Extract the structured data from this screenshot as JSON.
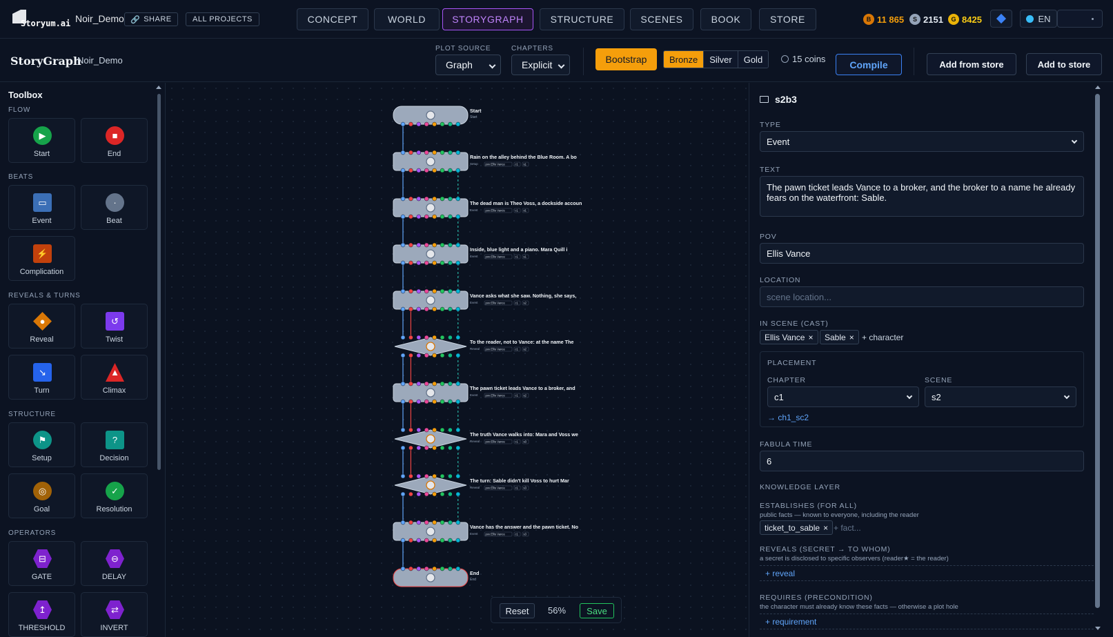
{
  "app": {
    "logo_text": "Storyum.ai",
    "project_name": "Noir_Demo",
    "share": "SHARE",
    "all_projects": "ALL PROJECTS"
  },
  "nav": {
    "tabs": [
      "CONCEPT",
      "WORLD",
      "STORYGRAPH",
      "STRUCTURE",
      "SCENES",
      "BOOK",
      "STORE"
    ],
    "active": "STORYGRAPH"
  },
  "wallet": {
    "bronze": "11 865",
    "silver": "2151",
    "gold": "8425",
    "bronze_letter": "B",
    "silver_letter": "S",
    "gold_letter": "G"
  },
  "lang": "EN",
  "subbar": {
    "title": "StoryGraph",
    "project": "Noir_Demo",
    "plot_source_label": "PLOT SOURCE",
    "plot_source_value": "Graph",
    "chapters_label": "CHAPTERS",
    "chapters_value": "Explicit",
    "bootstrap": "Bootstrap",
    "tiers": [
      "Bronze",
      "Silver",
      "Gold"
    ],
    "active_tier": "Bronze",
    "coins": "15 coins",
    "compile": "Compile",
    "add_from_store": "Add from store",
    "add_to_store": "Add to store"
  },
  "toolbox": {
    "title": "Toolbox",
    "sections": [
      "FLOW",
      "BEATS",
      "REVEALS & TURNS",
      "STRUCTURE",
      "OPERATORS"
    ],
    "tools": [
      {
        "label": "Start",
        "icon": "play-icon",
        "glyph": "▶",
        "color": "#16a34a"
      },
      {
        "label": "End",
        "icon": "stop-icon",
        "glyph": "■",
        "color": "#dc2626"
      },
      {
        "label": "Event",
        "icon": "event-icon",
        "glyph": "▭",
        "color": "#3b6fb6"
      },
      {
        "label": "Beat",
        "icon": "beat-icon",
        "glyph": "·",
        "color": "#64748b"
      },
      {
        "label": "Complication",
        "icon": "lightning-icon",
        "glyph": "⚡",
        "color": "#c2410c"
      },
      {
        "label": "Reveal",
        "icon": "bulb-icon",
        "glyph": "●",
        "color": "#d97706"
      },
      {
        "label": "Twist",
        "icon": "twist-icon",
        "glyph": "↺",
        "color": "#7c3aed"
      },
      {
        "label": "Turn",
        "icon": "turn-icon",
        "glyph": "↘",
        "color": "#2563eb"
      },
      {
        "label": "Climax",
        "icon": "climax-icon",
        "glyph": "▲",
        "color": "#dc2626"
      },
      {
        "label": "Setup",
        "icon": "flag-icon",
        "glyph": "⚑",
        "color": "#0d9488"
      },
      {
        "label": "Decision",
        "icon": "question-icon",
        "glyph": "?",
        "color": "#0d9488"
      },
      {
        "label": "Goal",
        "icon": "target-icon",
        "glyph": "◎",
        "color": "#a16207"
      },
      {
        "label": "Resolution",
        "icon": "check-icon",
        "glyph": "✓",
        "color": "#16a34a"
      },
      {
        "label": "GATE",
        "icon": "gate-icon",
        "glyph": "⊟",
        "color": "#7e22ce"
      },
      {
        "label": "DELAY",
        "icon": "delay-icon",
        "glyph": "⊖",
        "color": "#7e22ce"
      },
      {
        "label": "THRESHOLD",
        "icon": "threshold-icon",
        "glyph": "↥",
        "color": "#7e22ce"
      },
      {
        "label": "INVERT",
        "icon": "invert-icon",
        "glyph": "⇄",
        "color": "#7e22ce"
      }
    ]
  },
  "graph": {
    "nodes": [
      {
        "kind": "start",
        "title": "Start",
        "meta": "Start"
      },
      {
        "kind": "event",
        "title": "Rain on the alley behind the Blue Room. A bo",
        "type": "Setup",
        "pov": "pov:Ellis Vance",
        "ch": "c1",
        "sc": "s1"
      },
      {
        "kind": "event",
        "title": "The dead man is Theo Voss, a dockside accoun",
        "type": "Event",
        "pov": "pov:Ellis Vance",
        "ch": "c1",
        "sc": "s1"
      },
      {
        "kind": "event",
        "title": "Inside, blue light and a piano. Mara Quill i",
        "type": "Event",
        "pov": "pov:Ellis Vance",
        "ch": "c1",
        "sc": "s1"
      },
      {
        "kind": "event",
        "title": "Vance asks what she saw. Nothing, she says,",
        "type": "Event",
        "pov": "pov:Ellis Vance",
        "ch": "c1",
        "sc": "s2"
      },
      {
        "kind": "reveal",
        "title": "To the reader, not to Vance: at the name The",
        "type": "Reveal",
        "pov": "pov:Ellis Vance",
        "ch": "c1",
        "sc": "s2"
      },
      {
        "kind": "event",
        "title": "The pawn ticket leads Vance to a broker, and",
        "type": "Event",
        "pov": "pov:Ellis Vance",
        "ch": "c1",
        "sc": "s2"
      },
      {
        "kind": "reveal",
        "title": "The truth Vance walks into: Mara and Voss we",
        "type": "Reveal",
        "pov": "pov:Ellis Vance",
        "ch": "c1",
        "sc": "s3"
      },
      {
        "kind": "reveal",
        "title": "The turn: Sable didn't kill Voss to hurt Mar",
        "type": "Reveal",
        "pov": "pov:Ellis Vance",
        "ch": "c1",
        "sc": "s3"
      },
      {
        "kind": "event",
        "title": "Vance has the answer and the pawn ticket. No",
        "type": "Event",
        "pov": "pov:Ellis Vance",
        "ch": "c1",
        "sc": "s3"
      },
      {
        "kind": "end",
        "title": "End",
        "meta": "End"
      }
    ],
    "port_colors": [
      "#60a5fa",
      "#ef4444",
      "#a855f7",
      "#ec4899",
      "#f59e0b",
      "#22c55e",
      "#10b981",
      "#06b6d4"
    ]
  },
  "zoom": {
    "reset": "Reset",
    "value": "56%",
    "save": "Save"
  },
  "inspector": {
    "node_id": "s2b3",
    "type_label": "TYPE",
    "type_value": "Event",
    "text_label": "TEXT",
    "text_value": "The pawn ticket leads Vance to a broker, and the broker to a name he already fears on the waterfront: Sable.",
    "pov_label": "POV",
    "pov_value": "Ellis Vance",
    "location_label": "LOCATION",
    "location_placeholder": "scene location...",
    "cast_label": "IN SCENE (CAST)",
    "cast": [
      "Ellis Vance",
      "Sable"
    ],
    "add_character": "+ character",
    "placement_label": "PLACEMENT",
    "chapter_label": "CHAPTER",
    "chapter_value": "c1",
    "scene_label": "SCENE",
    "scene_value": "s2",
    "scene_link": "→ ch1_sc2",
    "fabula_label": "FABULA TIME",
    "fabula_value": "6",
    "knowledge_label": "KNOWLEDGE LAYER",
    "establishes_label": "ESTABLISHES (FOR ALL)",
    "establishes_hint": "public facts — known to everyone, including the reader",
    "establishes_chip": "ticket_to_sable",
    "fact_placeholder": "+ fact...",
    "reveals_label": "REVEALS (SECRET → TO WHOM)",
    "reveals_hint": "a secret is disclosed to specific observers (reader★ = the reader)",
    "add_reveal": "+ reveal",
    "requires_label": "REQUIRES (PRECONDITION)",
    "requires_hint": "the character must already know these facts — otherwise a plot hole",
    "add_requirement": "+ requirement"
  }
}
